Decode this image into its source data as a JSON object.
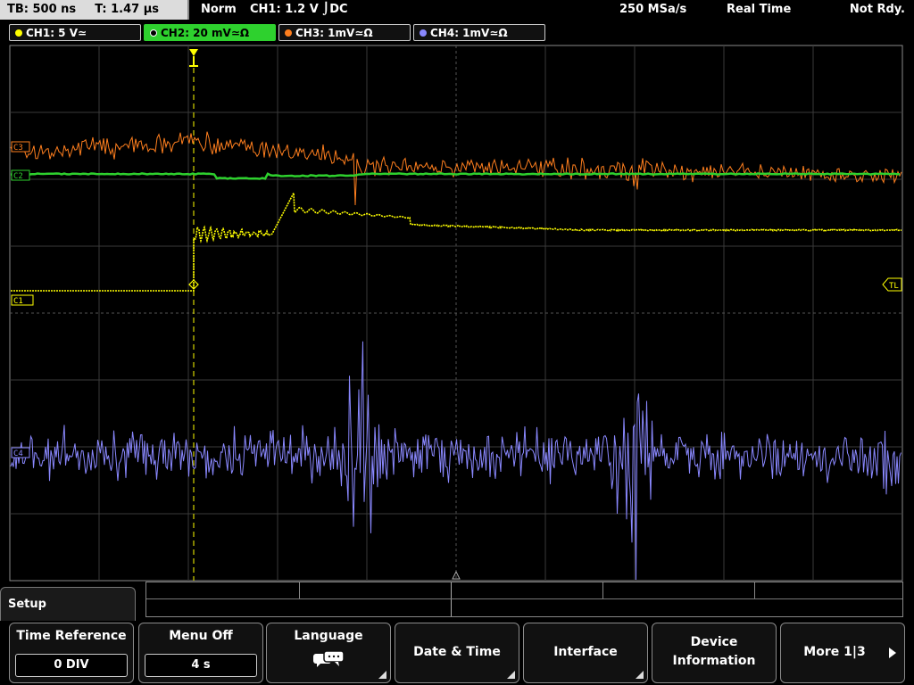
{
  "topbar": {
    "timebase": "TB: 500 ns",
    "trigger_pos": "T: 1.47 µs",
    "mode": "Norm",
    "trigger": "CH1: 1.2 V ⌡DC",
    "sample_rate": "250 MSa/s",
    "acq": "Real Time",
    "status": "Not Rdy."
  },
  "channels": [
    {
      "label": "CH1: 5 V≃",
      "color": "#ffff00",
      "active": false
    },
    {
      "label": "CH2: 20 mV≃Ω",
      "color": "#2ed12e",
      "active": true
    },
    {
      "label": "CH3: 1mV≃Ω",
      "color": "#ff7f1e",
      "active": false
    },
    {
      "label": "CH4: 1mV≃Ω",
      "color": "#8a88ff",
      "active": false
    }
  ],
  "markers": {
    "c3": "C3",
    "c2": "C2",
    "c1": "C1",
    "c4": "C4",
    "trigger_level": "TL"
  },
  "menu": {
    "panel_title": "Setup",
    "time_reference": {
      "label": "Time Reference",
      "value": "0 DIV"
    },
    "menu_off": {
      "label": "Menu Off",
      "value": "4 s"
    },
    "language": {
      "label": "Language"
    },
    "date_time": {
      "label": "Date & Time"
    },
    "interface": {
      "label": "Interface"
    },
    "device_info": {
      "label_1": "Device",
      "label_2": "Information"
    },
    "more": {
      "label": "More 1|3"
    }
  }
}
